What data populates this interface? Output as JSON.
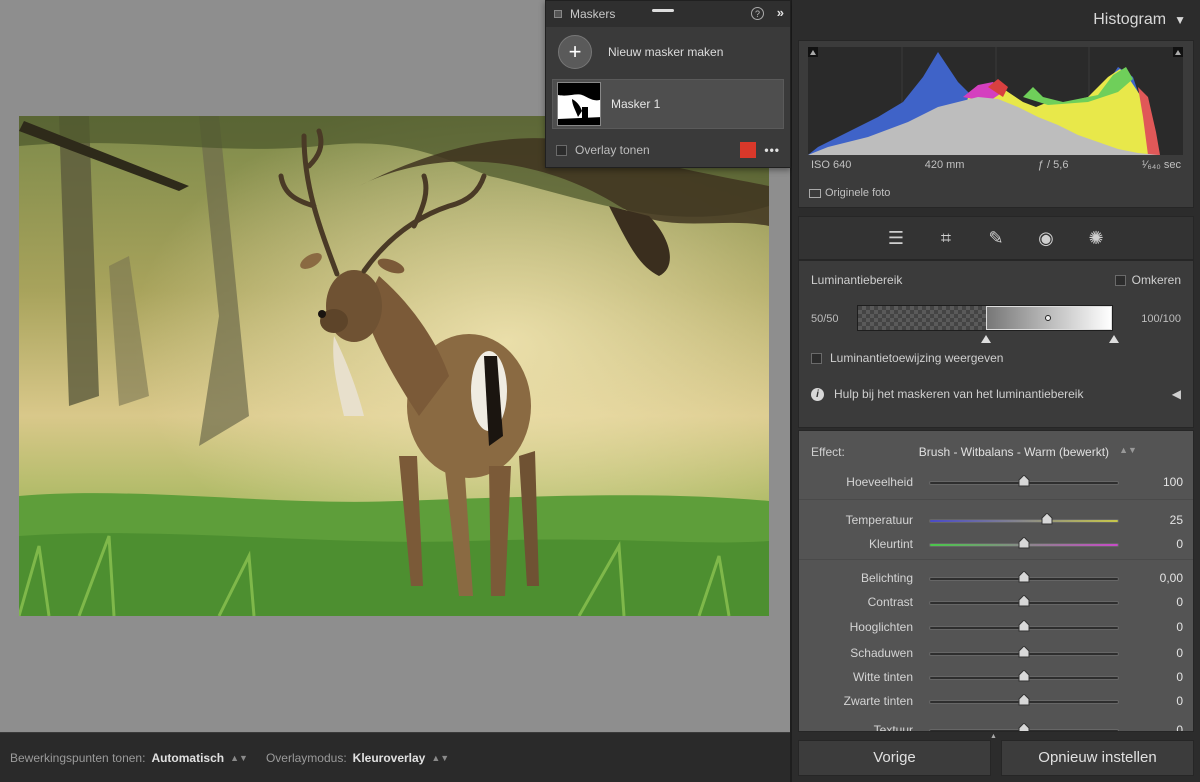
{
  "masks_panel": {
    "title": "Maskers",
    "new_mask_label": "Nieuw masker maken",
    "mask_items": [
      {
        "label": "Masker 1"
      }
    ],
    "overlay_label": "Overlay tonen",
    "overlay_color": "#d9382a",
    "help_icon": "?",
    "collapse_icon": "»",
    "more_icon": "•••"
  },
  "bottom_bar": {
    "pins_label": "Bewerkingspunten tonen:",
    "pins_value": "Automatisch",
    "overlay_mode_label": "Overlaymodus:",
    "overlay_mode_value": "Kleuroverlay"
  },
  "histogram": {
    "title": "Histogram",
    "iso": "ISO 640",
    "focal": "420 mm",
    "aperture": "ƒ / 5,6",
    "shutter": "¹⁄₆₄₀ sec",
    "original_photo_label": "Originele foto"
  },
  "tools": [
    "sliders-icon",
    "crop-icon",
    "heal-icon",
    "redeye-icon",
    "masking-icon"
  ],
  "luminance": {
    "title": "Luminantiebereik",
    "invert_label": "Omkeren",
    "left_value": "50/50",
    "right_value": "100/100",
    "show_map_label": "Luminantietoewijzing weergeven",
    "help_label": "Hulp bij het maskeren van het luminantiebereik"
  },
  "effect": {
    "label": "Effect:",
    "preset": "Brush - Witbalans - Warm (bewerkt)",
    "sliders": [
      {
        "label": "Hoeveelheid",
        "value": "100",
        "position": 0.5
      },
      {
        "label": "Temperatuur",
        "value": "25",
        "position": 0.62
      },
      {
        "label": "Kleurtint",
        "value": "0",
        "position": 0.5
      },
      {
        "label": "Belichting",
        "value": "0,00",
        "position": 0.5
      },
      {
        "label": "Contrast",
        "value": "0",
        "position": 0.5
      },
      {
        "label": "Hooglichten",
        "value": "0",
        "position": 0.5
      },
      {
        "label": "Schaduwen",
        "value": "0",
        "position": 0.5
      },
      {
        "label": "Witte tinten",
        "value": "0",
        "position": 0.5
      },
      {
        "label": "Zwarte tinten",
        "value": "0",
        "position": 0.5
      },
      {
        "label": "Textuur",
        "value": "0",
        "position": 0.5
      }
    ]
  },
  "buttons": {
    "previous": "Vorige",
    "reset": "Opnieuw instellen"
  }
}
